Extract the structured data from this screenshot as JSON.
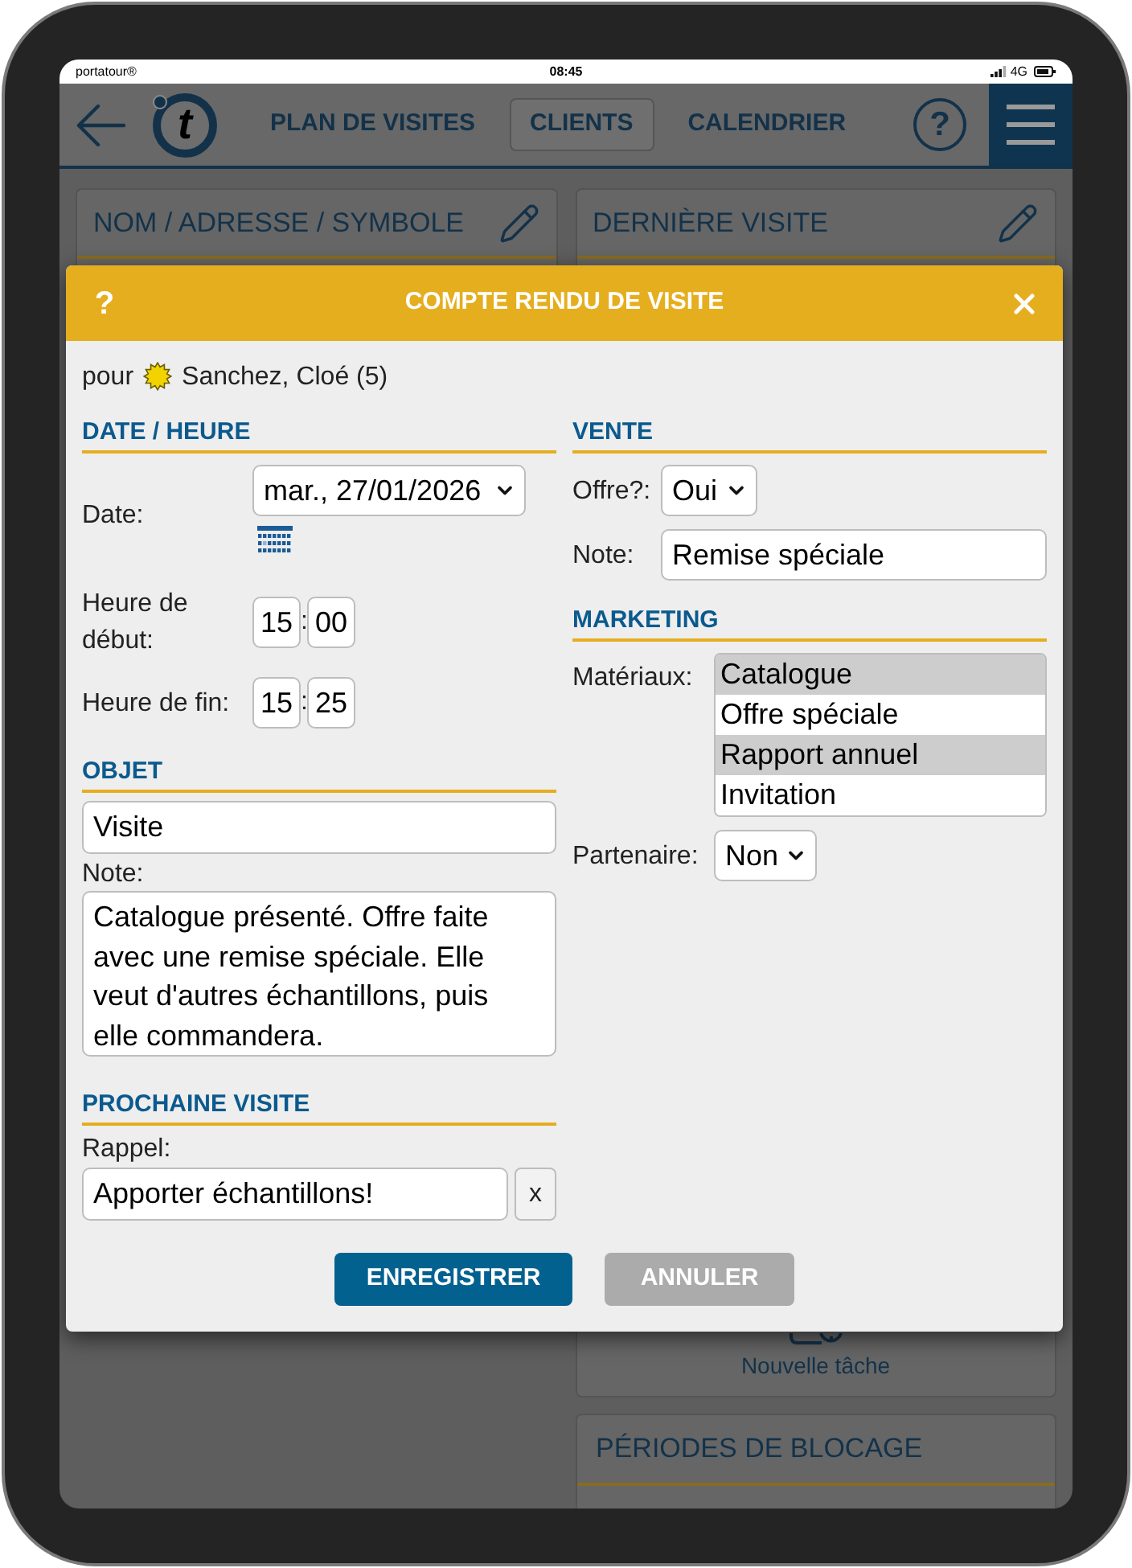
{
  "status_bar": {
    "carrier": "portatour®",
    "time": "08:45",
    "network": "4G"
  },
  "header": {
    "logo": "t",
    "tabs": [
      {
        "label": "PLAN DE VISITES",
        "selected": false
      },
      {
        "label": "CLIENTS",
        "selected": true
      },
      {
        "label": "CALENDRIER",
        "selected": false
      }
    ],
    "help": "?"
  },
  "cards": [
    {
      "title": "NOM / ADRESSE / SYMBOLE"
    },
    {
      "title": "DERNIÈRE VISITE"
    }
  ],
  "task_card": {
    "label": "Nouvelle tâche"
  },
  "blocking_card": {
    "title": "PÉRIODES DE BLOCAGE"
  },
  "dialog": {
    "help": "?",
    "title": "COMPTE RENDU DE VISITE",
    "prefix": "pour",
    "client": "Sanchez, Cloé (5)",
    "date_time": {
      "heading": "DATE / HEURE",
      "date": {
        "label": "Date:",
        "value": "mar., 27/01/2026"
      },
      "times": [
        {
          "label": "Heure de début:",
          "hour": "15",
          "separator": ":",
          "minute": "00"
        },
        {
          "label": "Heure de fin:",
          "hour": "15",
          "separator": ":",
          "minute": "25"
        }
      ]
    },
    "subject": {
      "heading": "OBJET",
      "value": "Visite",
      "note_label": "Note:",
      "note": "Catalogue présenté. Offre faite avec une remise spéciale. Elle veut d'autres échantillons, puis elle commandera."
    },
    "next_visit": {
      "heading": "PROCHAINE VISITE",
      "label": "Rappel:",
      "value": "Apporter échantillons!",
      "clear": "x"
    },
    "sale": {
      "heading": "VENTE",
      "offer": {
        "label": "Offre?:",
        "value": "Oui"
      },
      "note": {
        "label": "Note:",
        "value": "Remise spéciale"
      }
    },
    "marketing": {
      "heading": "MARKETING",
      "materials": {
        "label": "Matériaux:",
        "options": [
          {
            "label": "Catalogue",
            "selected": true
          },
          {
            "label": "Offre spéciale",
            "selected": false
          },
          {
            "label": "Rapport annuel",
            "selected": true
          },
          {
            "label": "Invitation",
            "selected": false
          }
        ]
      },
      "partner": {
        "label": "Partenaire:",
        "value": "Non"
      }
    },
    "buttons": [
      {
        "label": "ENREGISTRER",
        "kind": "primary"
      },
      {
        "label": "ANNULER",
        "kind": "secondary"
      }
    ]
  }
}
